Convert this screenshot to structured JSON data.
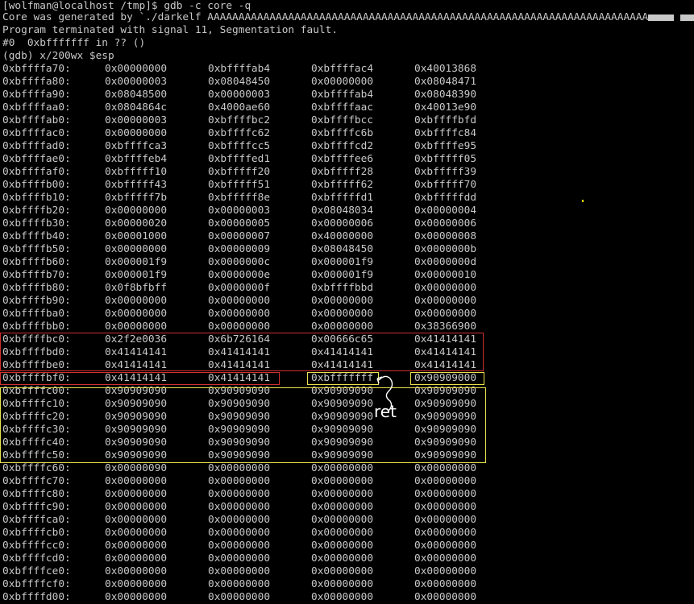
{
  "terminal": {
    "prompt_line": "[wolfman@localhost /tmp]$ gdb -c core -q",
    "core_line_prefix": "Core was generated by `./darkelf AAAAAAAAAAAAAAAAAAAAAAAAAAAAAAAAAAAAAAAAAAAAAAAAAAAAAAAAAAAAAAAAAAAAAAA",
    "core_line_suffix": "'.",
    "signal_line": "Program terminated with signal 11, Segmentation fault.",
    "frame_line": "#0  0xbfffffff in ?? ()",
    "command_line": "(gdb) x/200wx $esp"
  },
  "annotation": {
    "handwritten_label": "ret",
    "ink_color": "#ffffff",
    "yellow_box_color": "#e8e24c",
    "red_box_color": "#d03030"
  },
  "memory_rows": [
    {
      "addr": "0xbffffa70:",
      "words": [
        "0x00000000",
        "0xbffffab4",
        "0xbffffac4",
        "0x40013868"
      ]
    },
    {
      "addr": "0xbffffa80:",
      "words": [
        "0x00000003",
        "0x08048450",
        "0x00000000",
        "0x08048471"
      ]
    },
    {
      "addr": "0xbffffa90:",
      "words": [
        "0x08048500",
        "0x00000003",
        "0xbffffab4",
        "0x08048390"
      ]
    },
    {
      "addr": "0xbffffaa0:",
      "words": [
        "0x0804864c",
        "0x4000ae60",
        "0xbffffaac",
        "0x40013e90"
      ]
    },
    {
      "addr": "0xbffffab0:",
      "words": [
        "0x00000003",
        "0xbffffbc2",
        "0xbffffbcc",
        "0xbffffbfd"
      ]
    },
    {
      "addr": "0xbffffac0:",
      "words": [
        "0x00000000",
        "0xbffffc62",
        "0xbffffc6b",
        "0xbffffc84"
      ]
    },
    {
      "addr": "0xbffffad0:",
      "words": [
        "0xbffffca3",
        "0xbffffcc5",
        "0xbffffcd2",
        "0xbffffe95"
      ]
    },
    {
      "addr": "0xbffffae0:",
      "words": [
        "0xbffffeb4",
        "0xbffffed1",
        "0xbffffee6",
        "0xbfffff05"
      ]
    },
    {
      "addr": "0xbffffaf0:",
      "words": [
        "0xbfffff10",
        "0xbfffff20",
        "0xbfffff28",
        "0xbfffff39"
      ]
    },
    {
      "addr": "0xbffffb00:",
      "words": [
        "0xbfffff43",
        "0xbfffff51",
        "0xbfffff62",
        "0xbfffff70"
      ]
    },
    {
      "addr": "0xbffffb10:",
      "words": [
        "0xbfffff7b",
        "0xbfffff8e",
        "0xbfffffd1",
        "0xbfffffdd"
      ]
    },
    {
      "addr": "0xbffffb20:",
      "words": [
        "0x00000000",
        "0x00000003",
        "0x08048034",
        "0x00000004"
      ]
    },
    {
      "addr": "0xbffffb30:",
      "words": [
        "0x00000020",
        "0x00000005",
        "0x00000006",
        "0x00000006"
      ]
    },
    {
      "addr": "0xbffffb40:",
      "words": [
        "0x00001000",
        "0x00000007",
        "0x40000000",
        "0x00000008"
      ]
    },
    {
      "addr": "0xbffffb50:",
      "words": [
        "0x00000000",
        "0x00000009",
        "0x08048450",
        "0x0000000b"
      ]
    },
    {
      "addr": "0xbffffb60:",
      "words": [
        "0x000001f9",
        "0x0000000c",
        "0x000001f9",
        "0x0000000d"
      ]
    },
    {
      "addr": "0xbffffb70:",
      "words": [
        "0x000001f9",
        "0x0000000e",
        "0x000001f9",
        "0x00000010"
      ]
    },
    {
      "addr": "0xbffffb80:",
      "words": [
        "0x0f8bfbff",
        "0x0000000f",
        "0xbffffbbd",
        "0x00000000"
      ]
    },
    {
      "addr": "0xbffffb90:",
      "words": [
        "0x00000000",
        "0x00000000",
        "0x00000000",
        "0x00000000"
      ]
    },
    {
      "addr": "0xbffffba0:",
      "words": [
        "0x00000000",
        "0x00000000",
        "0x00000000",
        "0x00000000"
      ]
    },
    {
      "addr": "0xbffffbb0:",
      "words": [
        "0x00000000",
        "0x00000000",
        "0x00000000",
        "0x38366900"
      ]
    },
    {
      "addr": "0xbffffbc0:",
      "words": [
        "0x2f2e0036",
        "0x6b726164",
        "0x00666c65",
        "0x41414141"
      ]
    },
    {
      "addr": "0xbffffbd0:",
      "words": [
        "0x41414141",
        "0x41414141",
        "0x41414141",
        "0x41414141"
      ]
    },
    {
      "addr": "0xbffffbe0:",
      "words": [
        "0x41414141",
        "0x41414141",
        "0x41414141",
        "0x41414141"
      ]
    },
    {
      "addr": "0xbffffbf0:",
      "words": [
        "0x41414141",
        "0x41414141",
        "0xbfffffff",
        "0x90909000"
      ]
    },
    {
      "addr": "0xbffffc00:",
      "words": [
        "0x90909090",
        "0x90909090",
        "0x90909090",
        "0x90909090"
      ]
    },
    {
      "addr": "0xbffffc10:",
      "words": [
        "0x90909090",
        "0x90909090",
        "0x90909090",
        "0x90909090"
      ]
    },
    {
      "addr": "0xbffffc20:",
      "words": [
        "0x90909090",
        "0x90909090",
        "0x90909090",
        "0x90909090"
      ]
    },
    {
      "addr": "0xbffffc30:",
      "words": [
        "0x90909090",
        "0x90909090",
        "0x90909090",
        "0x90909090"
      ]
    },
    {
      "addr": "0xbffffc40:",
      "words": [
        "0x90909090",
        "0x90909090",
        "0x90909090",
        "0x90909090"
      ]
    },
    {
      "addr": "0xbffffc50:",
      "words": [
        "0x90909090",
        "0x90909090",
        "0x90909090",
        "0x90909090"
      ]
    },
    {
      "addr": "0xbffffc60:",
      "words": [
        "0x00000090",
        "0x00000000",
        "0x00000000",
        "0x00000000"
      ]
    },
    {
      "addr": "0xbffffc70:",
      "words": [
        "0x00000000",
        "0x00000000",
        "0x00000000",
        "0x00000000"
      ]
    },
    {
      "addr": "0xbffffc80:",
      "words": [
        "0x00000000",
        "0x00000000",
        "0x00000000",
        "0x00000000"
      ]
    },
    {
      "addr": "0xbffffc90:",
      "words": [
        "0x00000000",
        "0x00000000",
        "0x00000000",
        "0x00000000"
      ]
    },
    {
      "addr": "0xbffffca0:",
      "words": [
        "0x00000000",
        "0x00000000",
        "0x00000000",
        "0x00000000"
      ]
    },
    {
      "addr": "0xbffffcb0:",
      "words": [
        "0x00000000",
        "0x00000000",
        "0x00000000",
        "0x00000000"
      ]
    },
    {
      "addr": "0xbffffcc0:",
      "words": [
        "0x00000000",
        "0x00000000",
        "0x00000000",
        "0x00000000"
      ]
    },
    {
      "addr": "0xbffffcd0:",
      "words": [
        "0x00000000",
        "0x00000000",
        "0x00000000",
        "0x00000000"
      ]
    },
    {
      "addr": "0xbffffce0:",
      "words": [
        "0x00000000",
        "0x00000000",
        "0x00000000",
        "0x00000000"
      ]
    },
    {
      "addr": "0xbffffcf0:",
      "words": [
        "0x00000000",
        "0x00000000",
        "0x00000000",
        "0x00000000"
      ]
    },
    {
      "addr": "0xbffffd00:",
      "words": [
        "0x00000000",
        "0x00000000",
        "0x00000000",
        "0x00000000"
      ]
    }
  ]
}
